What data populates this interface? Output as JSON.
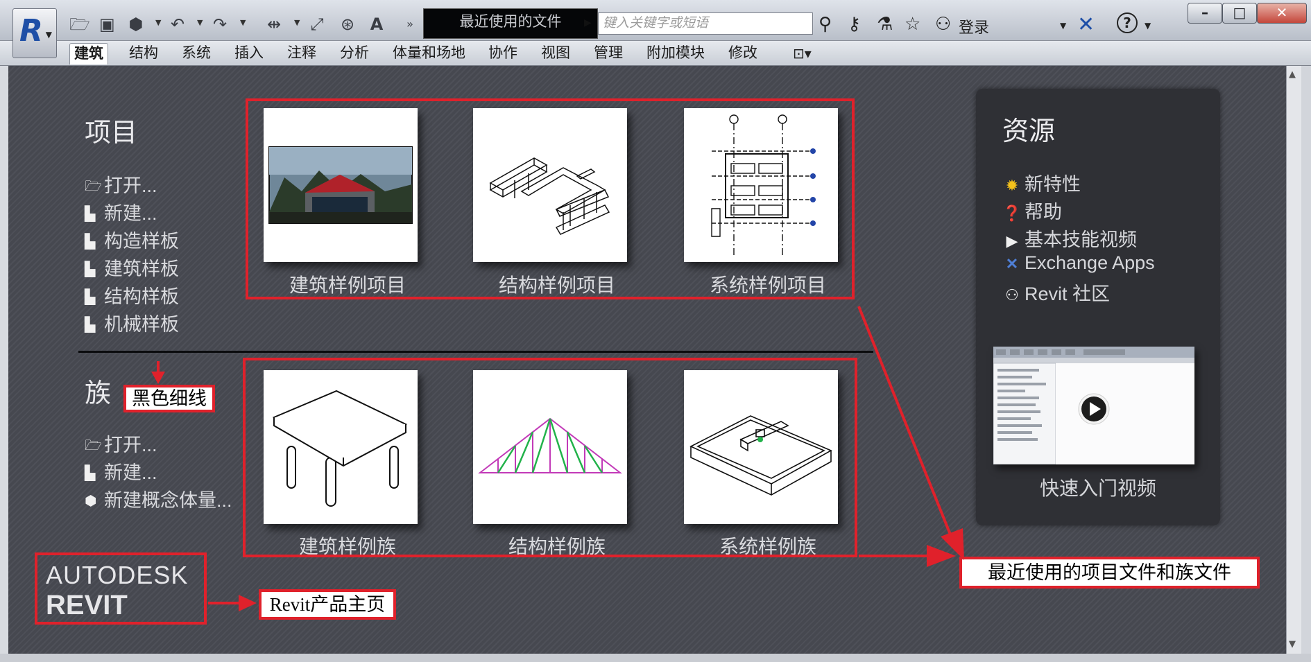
{
  "window": {
    "document_title": "最近使用的文件",
    "search_placeholder": "键入关键字或短语",
    "login_label": "登录"
  },
  "ribbon": {
    "tabs": [
      {
        "label": "建筑",
        "active": true
      },
      {
        "label": "结构"
      },
      {
        "label": "系统"
      },
      {
        "label": "插入"
      },
      {
        "label": "注释"
      },
      {
        "label": "分析"
      },
      {
        "label": "体量和场地"
      },
      {
        "label": "协作"
      },
      {
        "label": "视图"
      },
      {
        "label": "管理"
      },
      {
        "label": "附加模块"
      },
      {
        "label": "修改"
      }
    ]
  },
  "projects": {
    "heading": "项目",
    "links": [
      "打开...",
      "新建...",
      "构造样板",
      "建筑样板",
      "结构样板",
      "机械样板"
    ],
    "samples": [
      "建筑样例项目",
      "结构样例项目",
      "系统样例项目"
    ]
  },
  "families": {
    "heading": "族",
    "links": [
      "打开...",
      "新建...",
      "新建概念体量..."
    ],
    "samples": [
      "建筑样例族",
      "结构样例族",
      "系统样例族"
    ]
  },
  "resources": {
    "heading": "资源",
    "items": [
      "新特性",
      "帮助",
      "基本技能视频",
      "Exchange Apps",
      "Revit 社区"
    ],
    "video_label": "快速入门视频"
  },
  "branding": {
    "company": "AUTODESK",
    "product": "REVIT"
  },
  "annotations": {
    "divider_note": "黑色细线",
    "home_note": "Revit产品主页",
    "recent_note": "最近使用的项目文件和族文件"
  },
  "colors": {
    "annotation_red": "#e0212b",
    "background": "#484a52",
    "panel": "#2f3035"
  }
}
